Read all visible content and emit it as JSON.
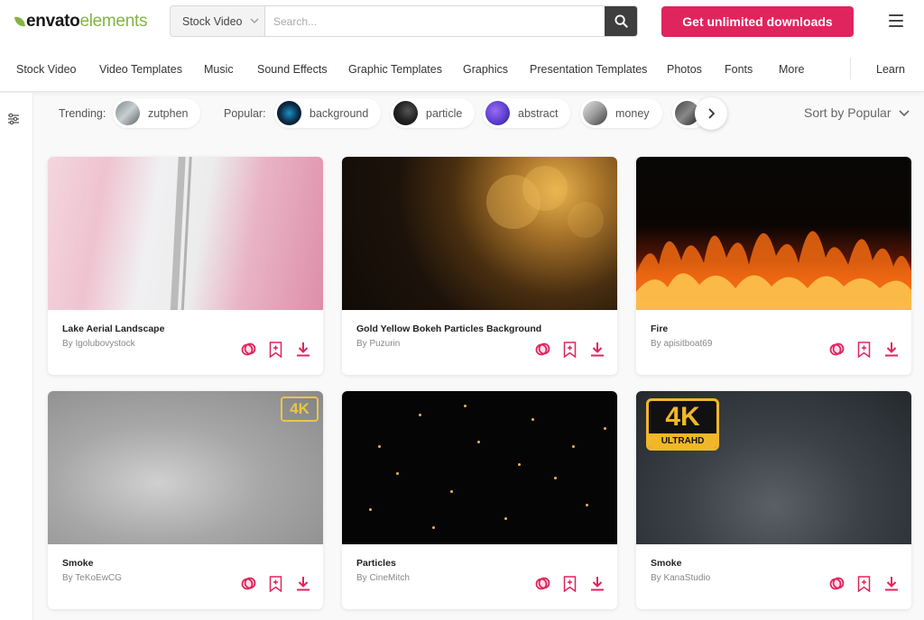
{
  "header": {
    "logo_part1": "envato",
    "logo_part2": "elements",
    "search_category": "Stock Video",
    "search_placeholder": "Search...",
    "cta_label": "Get unlimited downloads"
  },
  "nav": {
    "items": [
      "Stock Video",
      "Video Templates",
      "Music",
      "Sound Effects",
      "Graphic Templates",
      "Graphics",
      "Presentation Templates",
      "Photos",
      "Fonts",
      "More"
    ],
    "learn": "Learn"
  },
  "tags": {
    "trending_label": "Trending:",
    "trending": [
      {
        "label": "zutphen"
      }
    ],
    "popular_label": "Popular:",
    "popular": [
      {
        "label": "background"
      },
      {
        "label": "particle"
      },
      {
        "label": "abstract"
      },
      {
        "label": "money"
      }
    ],
    "sort_label": "Sort by Popular"
  },
  "cards": [
    {
      "title": "Lake Aerial Landscape",
      "author": "By Igolubovystock"
    },
    {
      "title": "Gold Yellow Bokeh Particles Background",
      "author": "By Puzurin"
    },
    {
      "title": "Fire",
      "author": "By apisitboat69"
    },
    {
      "title": "Smoke",
      "author": "By TeKoEwCG",
      "badge": "4K"
    },
    {
      "title": "Particles",
      "author": "By CineMitch"
    },
    {
      "title": "Smoke",
      "author": "By KanaStudio",
      "badge_top": "4K",
      "badge_bottom": "ULTRAHD"
    }
  ],
  "colors": {
    "accent": "#e0245e",
    "brand_green": "#82b541"
  },
  "icons": {
    "search": "search-icon",
    "menu": "hamburger-icon",
    "filter": "filter-icon",
    "next": "chevron-right-icon",
    "similar": "similar-icon",
    "collection": "bookmark-add-icon",
    "download": "download-icon"
  }
}
